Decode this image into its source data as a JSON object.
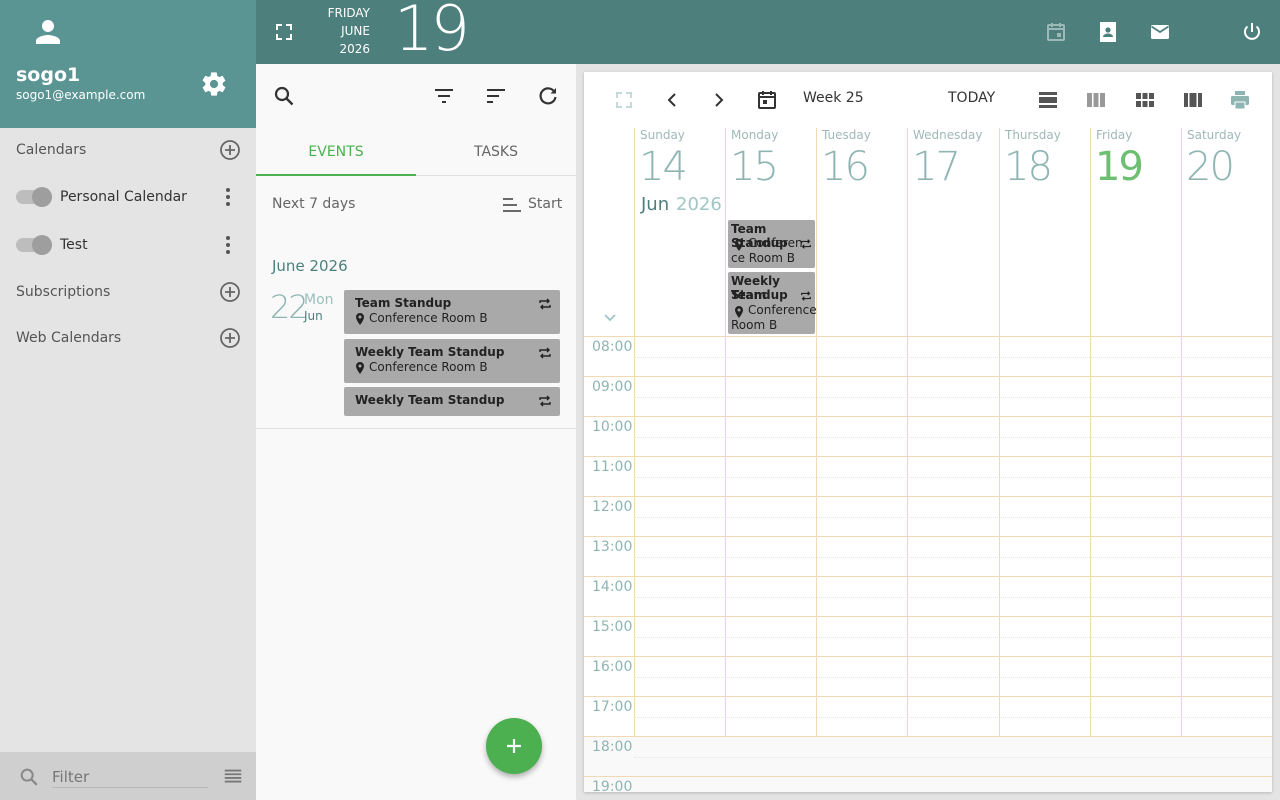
{
  "colors": {
    "teal": "#4d7f7d",
    "teal_light": "#5a9593",
    "green": "#4caf50",
    "event_gray": "#a9a9a9"
  },
  "user": {
    "name": "sogo1",
    "email": "sogo1@example.com",
    "icons": [
      "avatar-icon",
      "gear-icon"
    ]
  },
  "sidebar": {
    "calendars_label": "Calendars",
    "calendars": [
      {
        "name": "Personal Calendar",
        "enabled": false
      },
      {
        "name": "Test",
        "enabled": false
      }
    ],
    "subscriptions_label": "Subscriptions",
    "web_calendars_label": "Web Calendars",
    "filter_placeholder": "Filter"
  },
  "topbar": {
    "weekday": "FRIDAY",
    "month": "JUNE",
    "year": "2026",
    "day": "19",
    "icons": [
      "fullscreen-icon",
      "calendar-icon",
      "contacts-icon",
      "mail-icon",
      "power-icon"
    ]
  },
  "list": {
    "tabs": [
      "EVENTS",
      "TASKS"
    ],
    "active_tab": "EVENTS",
    "range": "Next 7 days",
    "sort": "Start",
    "month_heading": "June 2026",
    "day": {
      "num": "22",
      "dow": "Mon",
      "mon": "Jun"
    },
    "events": [
      {
        "title": "Team Standup",
        "location": "Conference Room B",
        "recurring": true
      },
      {
        "title": "Weekly Team Standup",
        "location": "Conference Room B",
        "recurring": true
      },
      {
        "title": "Weekly Team Standup",
        "location": "",
        "recurring": true
      }
    ]
  },
  "calendar": {
    "week_label": "Week 25",
    "today_label": "TODAY",
    "month_short": "Jun",
    "year": "2026",
    "days": [
      {
        "name": "Sunday",
        "num": "14",
        "today": false
      },
      {
        "name": "Monday",
        "num": "15",
        "today": false
      },
      {
        "name": "Tuesday",
        "num": "16",
        "today": false
      },
      {
        "name": "Wednesday",
        "num": "17",
        "today": false
      },
      {
        "name": "Thursday",
        "num": "18",
        "today": false
      },
      {
        "name": "Friday",
        "num": "19",
        "today": true
      },
      {
        "name": "Saturday",
        "num": "20",
        "today": false
      }
    ],
    "allday_events": [
      {
        "day": "Monday",
        "title": "Team Standup",
        "location": "Conferen ce Room B"
      },
      {
        "day": "Monday",
        "title": "Weekly Team Standup",
        "location": "Conference Room B"
      }
    ],
    "allday_event_lines": {
      "e1_title": "Team Standup",
      "e1_loc1": "Conferen",
      "e1_loc2": "ce Room B",
      "e2_title1": "Weekly Team",
      "e2_title2": "Standup",
      "e2_loc1": "Conference",
      "e2_loc2": "Room B"
    },
    "hours": [
      "08:00",
      "09:00",
      "10:00",
      "11:00",
      "12:00",
      "13:00",
      "14:00",
      "15:00",
      "16:00",
      "17:00",
      "18:00",
      "19:00"
    ]
  }
}
